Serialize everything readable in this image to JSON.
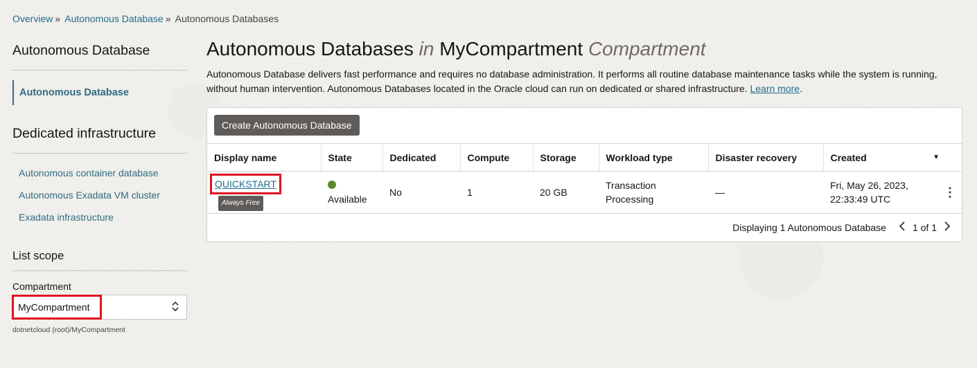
{
  "breadcrumb": {
    "items": [
      "Overview",
      "Autonomous Database",
      "Autonomous Databases"
    ],
    "separator": "»"
  },
  "sidebar": {
    "heading": "Autonomous Database",
    "active_item": "Autonomous Database",
    "dedicated_heading": "Dedicated infrastructure",
    "dedicated_items": [
      "Autonomous container database",
      "Autonomous Exadata VM cluster",
      "Exadata infrastructure"
    ],
    "scope_heading": "List scope",
    "compartment_label": "Compartment",
    "compartment_value": "MyCompartment",
    "compartment_path": "dotnetcloud (root)/MyCompartment"
  },
  "main": {
    "title_part1": "Autonomous Databases",
    "title_in": "in",
    "title_compartment": "MyCompartment",
    "title_suffix": "Compartment",
    "description": "Autonomous Database delivers fast performance and requires no database administration. It performs all routine database maintenance tasks while the system is running, without human intervention. Autonomous Databases located in the Oracle cloud can run on dedicated or shared infrastructure.",
    "learn_more": "Learn more",
    "create_button": "Create Autonomous Database"
  },
  "table": {
    "columns": [
      "Display name",
      "State",
      "Dedicated",
      "Compute",
      "Storage",
      "Workload type",
      "Disaster recovery",
      "Created"
    ],
    "rows": [
      {
        "display_name": "QUICKSTART",
        "badge": "Always Free",
        "state": "Available",
        "dedicated": "No",
        "compute": "1",
        "storage": "20 GB",
        "workload_line1": "Transaction",
        "workload_line2": "Processing",
        "disaster_recovery": "—",
        "created_line1": "Fri, May 26, 2023,",
        "created_line2": "22:33:49 UTC"
      }
    ],
    "footer_text": "Displaying 1 Autonomous Database",
    "pagination": "1 of 1"
  },
  "colors": {
    "link": "#1f6d8c",
    "highlight": "#e0121e",
    "available": "#5b8a2c",
    "button": "#5f5b58"
  }
}
